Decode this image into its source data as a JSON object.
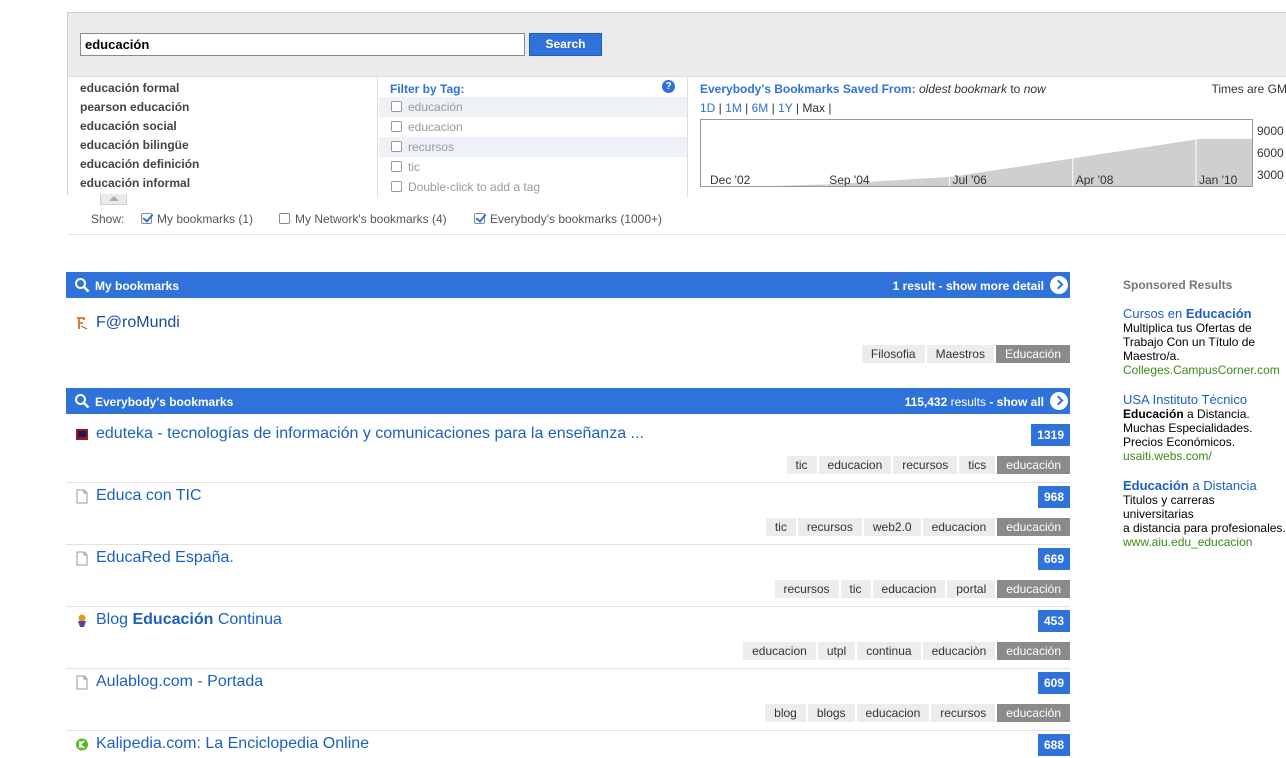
{
  "search": {
    "query": "educación",
    "button": "Search"
  },
  "suggestions": [
    "educación formal",
    "pearson educación",
    "educación social",
    "educación bilingüe",
    "educación definición",
    "educación informal"
  ],
  "filter": {
    "title": "Filter by Tag:",
    "help": "?",
    "tags": [
      "educación",
      "educacion",
      "recursos",
      "tic"
    ],
    "add_placeholder": "Double-click to add a tag"
  },
  "saved": {
    "label": "Everybody's Bookmarks Saved From:",
    "from": "oldest bookmark",
    "to_word": "to",
    "to": "now",
    "time_note": "Times are GM",
    "ranges": [
      "1D",
      "1M",
      "6M",
      "1Y",
      "Max"
    ],
    "x_labels": [
      "Dec '02",
      "Sep '04",
      "Jul '06",
      "Apr '08",
      "Jan '10"
    ],
    "y_labels": [
      "9000",
      "6000",
      "3000"
    ]
  },
  "chart_data": {
    "type": "area",
    "x": [
      "Dec '02",
      "Sep '04",
      "Jul '06",
      "Apr '08",
      "Jan '10"
    ],
    "y": [
      0,
      500,
      1500,
      4000,
      6500
    ],
    "ylim": [
      0,
      9000
    ]
  },
  "show": {
    "label": "Show:",
    "options": [
      {
        "label": "My bookmarks (1)",
        "checked": true
      },
      {
        "label": "My Network's bookmarks (4)",
        "checked": false
      },
      {
        "label": "Everybody's bookmarks (1000+)",
        "checked": true
      }
    ]
  },
  "my_bookmarks": {
    "title": "My bookmarks",
    "count": "1 result",
    "more": "- show more detail",
    "item": {
      "title": "F@roMundi",
      "tags": [
        "Filosofia",
        "Maestros",
        "Educación"
      ],
      "highlight": "Educación"
    }
  },
  "everybody": {
    "title": "Everybody's bookmarks",
    "count": "115,432",
    "count_suffix": "results",
    "more": "- show all",
    "items": [
      {
        "title": "eduteka - tecnologías de información y comunicaciones para la enseñanza ...",
        "count": "1319",
        "tags": [
          "tic",
          "educacion",
          "recursos",
          "tics",
          "educación"
        ],
        "icon": "eduteka-icon"
      },
      {
        "title": "Educa con TIC",
        "count": "968",
        "tags": [
          "tic",
          "recursos",
          "web2.0",
          "educacion",
          "educación"
        ],
        "icon": "page-icon"
      },
      {
        "title": "EducaRed España.",
        "count": "669",
        "tags": [
          "recursos",
          "tic",
          "educacion",
          "portal",
          "educación"
        ],
        "icon": "page-icon"
      },
      {
        "title_pre": "Blog ",
        "title_bold": "Educación",
        "title_post": " Continua",
        "count": "453",
        "tags": [
          "educacion",
          "utpl",
          "continua",
          "educaciòn",
          "educación"
        ],
        "icon": "blog-icon"
      },
      {
        "title": "Aulablog.com - Portada",
        "count": "609",
        "tags": [
          "blog",
          "blogs",
          "educacion",
          "recursos",
          "educación"
        ],
        "icon": "page-icon"
      },
      {
        "title": "Kalipedia.com: La Enciclopedia Online",
        "count": "688",
        "tags": [],
        "icon": "kalipedia-icon"
      }
    ]
  },
  "sponsored": {
    "heading": "Sponsored Results",
    "ads": [
      {
        "title_pre": "Cursos en ",
        "title_bold": "Educación",
        "body_bold": "",
        "body": "Multiplica tus Ofertas de\nTrabajo Con un Título de\nMaestro/a.",
        "url": "Colleges.CampusCorner.com"
      },
      {
        "title_pre": "USA Instituto Técnico",
        "title_bold": "",
        "body_bold": "Educación",
        "body": " a Distancia.\nMuchas Especialidades.\nPrecios Económicos.",
        "url": "usaiti.webs.com/"
      },
      {
        "title_pre": "",
        "title_bold": "Educación",
        "title_post": " a Distancia",
        "body_bold": "",
        "body": "Titulos y carreras universitarias\na distancia para profesionales.",
        "url": "www.aiu.edu_educacion"
      }
    ]
  }
}
